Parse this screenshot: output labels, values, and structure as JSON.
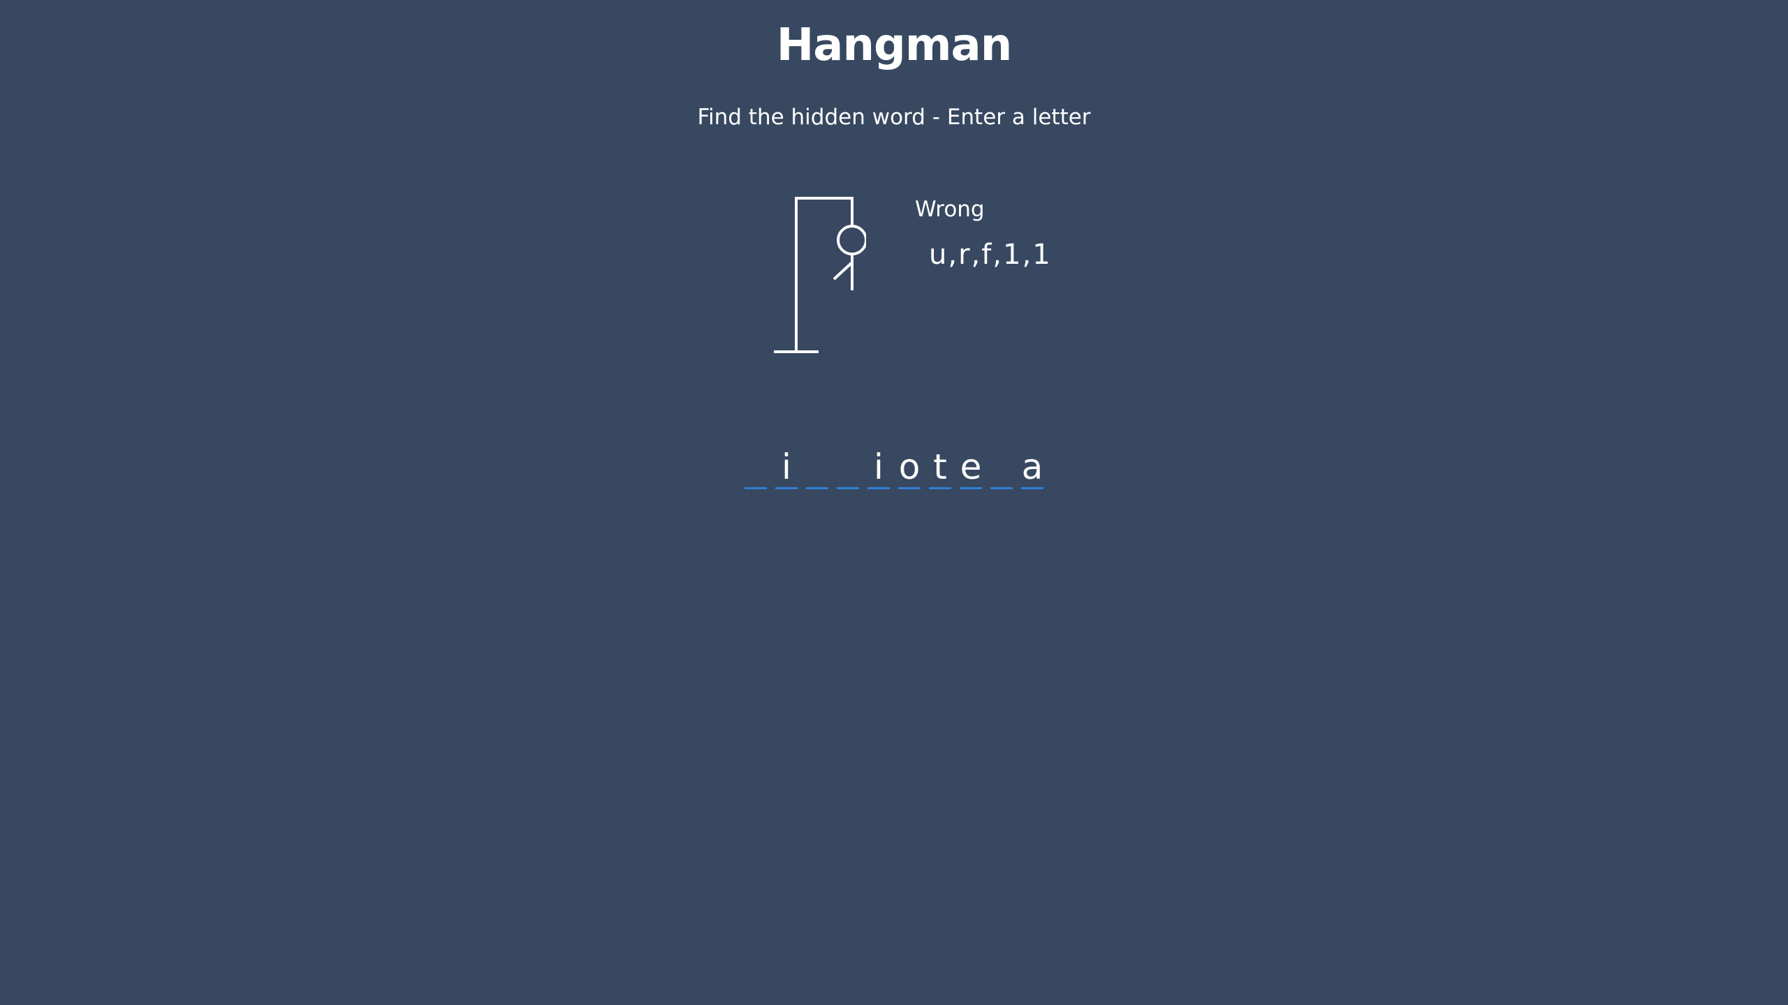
{
  "game": {
    "title": "Hangman",
    "instructions": "Find the hidden word - Enter a letter",
    "wrong_label": "Wrong",
    "wrong_letters_text": "u,r,f,1,1",
    "word_slots": [
      "",
      "i",
      "",
      "",
      "i",
      "o",
      "t",
      "e",
      "",
      "a"
    ],
    "hangman_parts_shown": [
      "head",
      "body",
      "left-arm"
    ]
  },
  "colors": {
    "background": "#374860",
    "text": "#ffffff",
    "slot_underline": "#2f80d6"
  }
}
